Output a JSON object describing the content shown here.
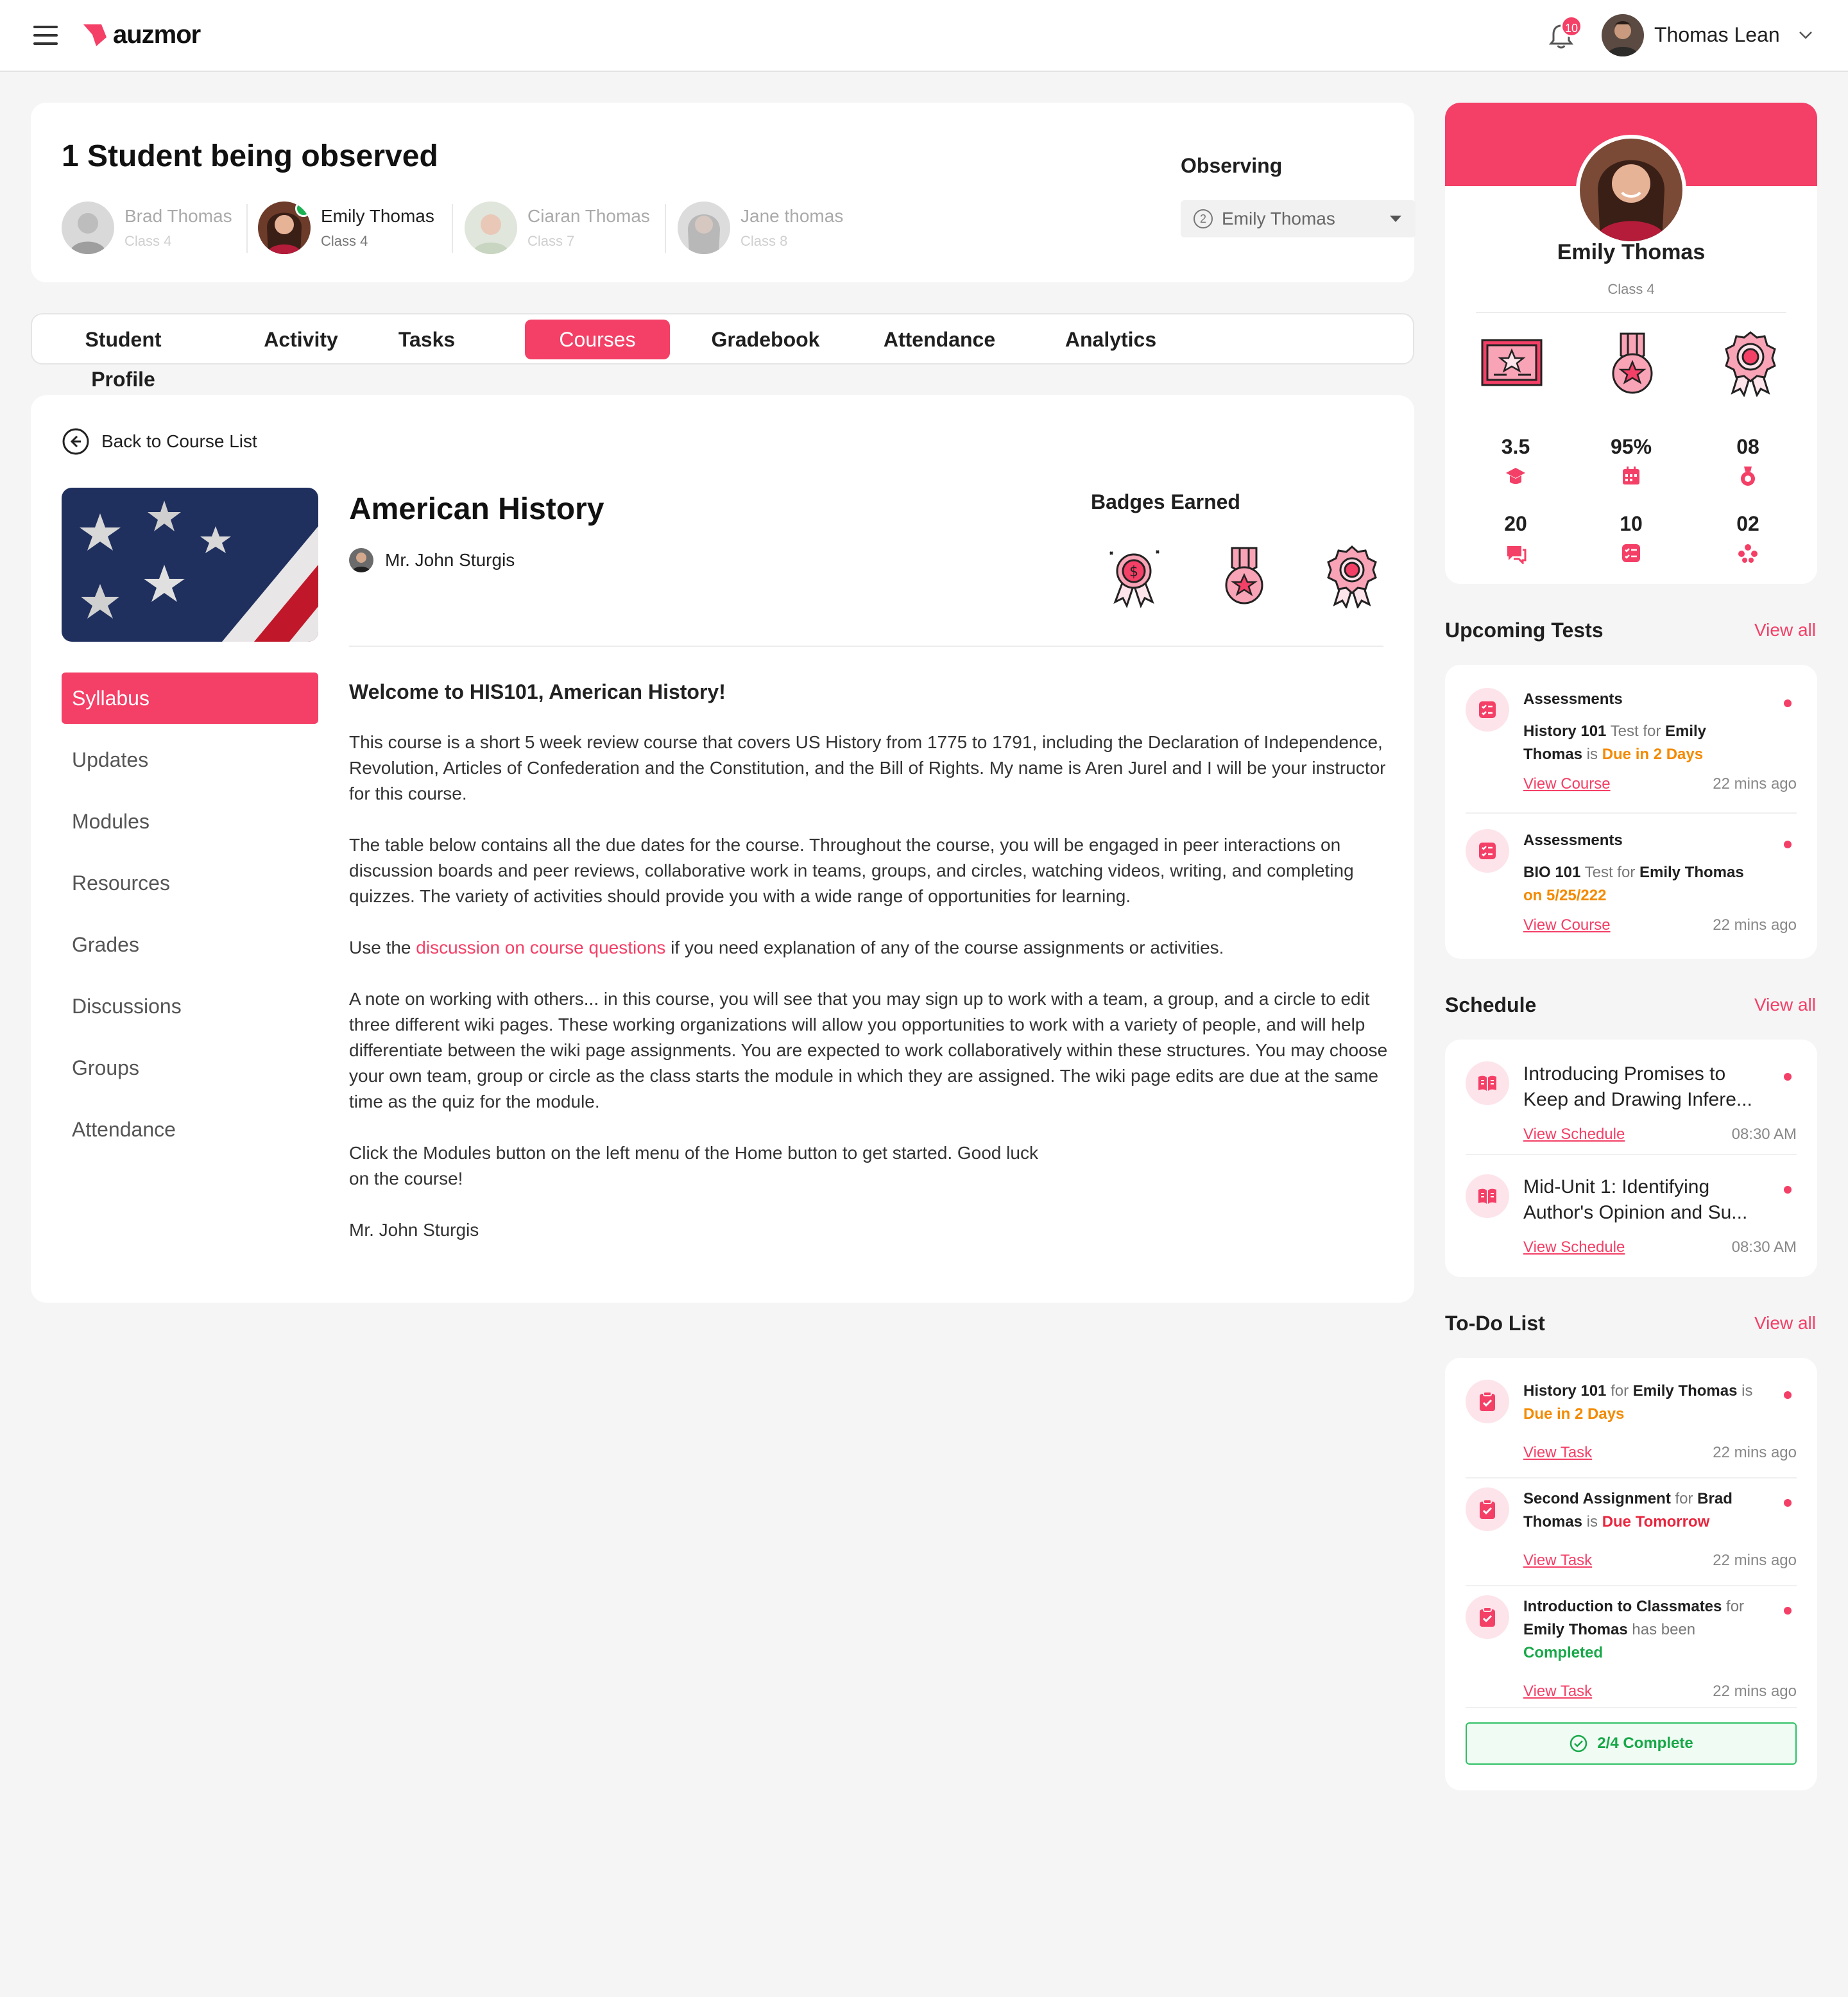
{
  "header": {
    "brand": "auzmor",
    "notification_count": "10",
    "user_name": "Thomas Lean"
  },
  "observed": {
    "title": "1 Student being observed",
    "students": [
      {
        "name": "Brad Thomas",
        "class": "Class 4"
      },
      {
        "name": "Emily Thomas",
        "class": "Class 4"
      },
      {
        "name": "Ciaran Thomas",
        "class": "Class 7"
      },
      {
        "name": "Jane thomas",
        "class": "Class 8"
      }
    ],
    "observing_label": "Observing",
    "observing_count": "2",
    "observing_value": "Emily Thomas"
  },
  "tabs": [
    "Student Profile",
    "Activity",
    "Tasks",
    "Courses",
    "Gradebook",
    "Attendance",
    "Analytics"
  ],
  "course": {
    "back_label": "Back to Course List",
    "title": "American History",
    "instructor": "Mr. John Sturgis",
    "badges_label": "Badges Earned",
    "side_nav": [
      "Syllabus",
      "Updates",
      "Modules",
      "Resources",
      "Grades",
      "Discussions",
      "Groups",
      "Attendance"
    ],
    "welcome": "Welcome to HIS101, American History!",
    "p1": "This course is a short 5 week review course that covers US History from 1775 to 1791, including the Declaration of Independence, Revolution, Articles of Confederation and the Constitution, and the Bill of Rights. My name is Aren Jurel and I will be your instructor for this course.",
    "p2": "The table below contains all the due dates for the course. Throughout the course, you will be engaged in peer interactions on discussion boards and peer reviews, collaborative work in teams, groups, and circles, watching videos, writing, and completing quizzes. The variety of activities should provide you with a wide range of  opportunities for learning.",
    "p3_pre": "Use the ",
    "p3_link": "discussion on course questions",
    "p3_post": " if you need explanation of any of the course assignments or activities.",
    "p4": "A note on working with others... in this course, you will see that you may sign up to work with a team, a group, and a circle to edit three different wiki pages. These working organizations will allow you opportunities to work with a variety of people, and will help differentiate between the wiki page assignments. You are expected to work collaboratively within these structures. You may choose your own team, group or circle as the class starts the module in which they are assigned. The wiki page edits are due at the same time as the quiz for the module.",
    "p5": "Click the Modules button on the left menu of the Home button to get started. Good luck on the course!",
    "signature": "Mr. John Sturgis"
  },
  "profile": {
    "name": "Emily Thomas",
    "class": "Class 4",
    "stats": [
      {
        "value": "3.5",
        "icon": "graduation-cap-icon"
      },
      {
        "value": "95%",
        "icon": "calendar-icon"
      },
      {
        "value": "08",
        "icon": "medal-icon"
      },
      {
        "value": "20",
        "icon": "chat-icon"
      },
      {
        "value": "10",
        "icon": "checklist-icon"
      },
      {
        "value": "02",
        "icon": "group-icon"
      }
    ]
  },
  "upcoming": {
    "title": "Upcoming Tests",
    "view_all": "View all",
    "items": [
      {
        "type": "Assessments",
        "course": "History 101",
        "mid": " Test for ",
        "who": "Emily Thomas",
        "is": " is ",
        "status": "Due in 2 Days",
        "link": "View Course",
        "time": "22 mins ago"
      },
      {
        "type": "Assessments",
        "course": "BIO 101",
        "mid": " Test for ",
        "who": "Emily Thomas",
        "status": "on 5/25/222",
        "link": "View Course",
        "time": "22 mins ago"
      }
    ]
  },
  "schedule": {
    "title": "Schedule",
    "view_all": "View all",
    "items": [
      {
        "title": "Introducing Promises to Keep and Drawing Infere...",
        "link": "View Schedule",
        "time": "08:30 AM"
      },
      {
        "title": "Mid-Unit 1: Identifying Author's Opinion and Su...",
        "link": "View Schedule",
        "time": "08:30 AM"
      }
    ]
  },
  "todo": {
    "title": "To-Do List",
    "view_all": "View all",
    "items": [
      {
        "task": "History 101",
        "for": " for ",
        "who": "Emily Thomas",
        "is": " is ",
        "status": "Due in 2 Days",
        "link": "View Task",
        "time": "22 mins ago"
      },
      {
        "task": "Second Assignment",
        "for": " for ",
        "who": "Brad Thomas",
        "is": " is ",
        "status": "Due Tomorrow",
        "link": "View Task",
        "time": "22 mins ago"
      },
      {
        "task": "Introduction to Classmates",
        "for": " for ",
        "who": "Emily Thomas",
        "is": " has been ",
        "status": "Completed",
        "link": "View Task",
        "time": "22 mins ago"
      }
    ],
    "complete_label": "2/4 Complete"
  },
  "colors": {
    "accent": "#f43f66",
    "due": "#f38a00",
    "danger": "#e8243d",
    "success": "#18a849"
  }
}
